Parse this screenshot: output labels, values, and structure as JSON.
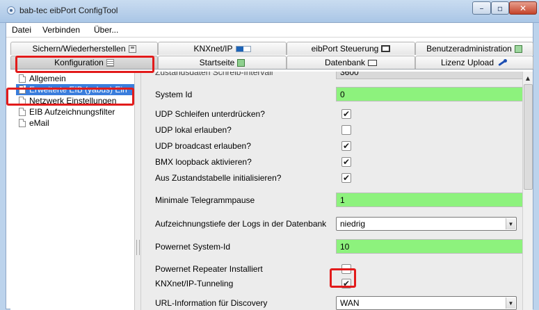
{
  "window": {
    "title": "bab-tec eibPort ConfigTool",
    "icons": {
      "app": "app-icon",
      "minimize": "minimize-icon",
      "maximize": "maximize-icon",
      "close": "close-icon"
    },
    "minimize_glyph": "–",
    "maximize_glyph": "▫",
    "close_glyph": "✕"
  },
  "menu": {
    "items": [
      "Datei",
      "Verbinden",
      "Über..."
    ]
  },
  "tabs": {
    "row1": [
      {
        "label": "Sichern/Wiederherstellen",
        "icon": "save-icon"
      },
      {
        "label": "KNXnet/IP",
        "icon": "knx-icon"
      },
      {
        "label": "eibPort Steuerung",
        "icon": "monitor-icon"
      },
      {
        "label": "Benutzeradministration",
        "icon": "users-icon"
      }
    ],
    "row2": [
      {
        "label": "Konfiguration",
        "icon": "config-icon",
        "active": true
      },
      {
        "label": "Startseite",
        "icon": "startpage-icon"
      },
      {
        "label": "Datenbank",
        "icon": "database-icon"
      },
      {
        "label": "Lizenz Upload",
        "icon": "key-icon"
      }
    ]
  },
  "tree": {
    "items": [
      {
        "label": "Allgemein"
      },
      {
        "label": "Erweiterte EIB (yabus) Ein",
        "selected": true
      },
      {
        "label": "Netzwerk Einstellungen"
      },
      {
        "label": "EIB Aufzeichnungsfilter"
      },
      {
        "label": "eMail"
      }
    ]
  },
  "settings": {
    "partial_row": {
      "label": "Zustandsdaten Schreib-Intervall",
      "value": "3600"
    },
    "system_id": {
      "label": "System Id",
      "value": "0"
    },
    "udp_loop": {
      "label": "UDP Schleifen unterdrücken?",
      "checked": true
    },
    "udp_local": {
      "label": "UDP lokal erlauben?",
      "checked": false
    },
    "udp_broadcast": {
      "label": "UDP broadcast erlauben?",
      "checked": true
    },
    "bmx_loopback": {
      "label": "BMX loopback aktivieren?",
      "checked": true
    },
    "init_from_state": {
      "label": "Aus Zustandstabelle initialisieren?",
      "checked": true
    },
    "min_pause": {
      "label": "Minimale Telegrammpause",
      "value": "1"
    },
    "log_depth": {
      "label": "Aufzeichnungstiefe der Logs in der Datenbank",
      "value": "niedrig"
    },
    "powernet_id": {
      "label": "Powernet System-Id",
      "value": "10"
    },
    "powernet_repeater": {
      "label": "Powernet Repeater Installiert",
      "checked": false
    },
    "knx_tunneling": {
      "label": "KNXnet/IP-Tunneling",
      "checked": true
    },
    "url_discovery": {
      "label": "URL-Information für Discovery",
      "value": "WAN"
    },
    "check_glyph": "✔",
    "dropdown_glyph": "▼"
  },
  "colors": {
    "highlight": "#e21b1b",
    "field_green": "#8df27d",
    "selection": "#3a7ddc"
  }
}
